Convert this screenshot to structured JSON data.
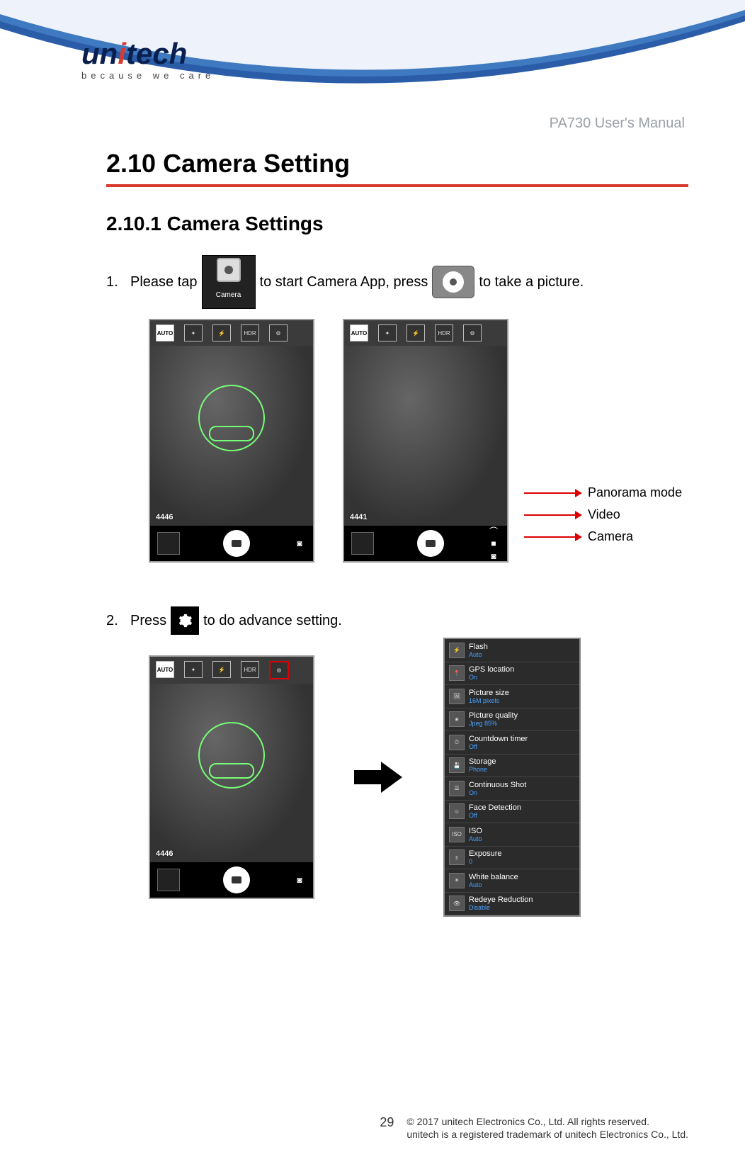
{
  "header": {
    "logo_text": "unitech",
    "tagline": "because we care",
    "manual_title": "PA730 User's Manual"
  },
  "section": {
    "heading": "2.10 Camera Setting",
    "subheading": "2.10.1 Camera Settings"
  },
  "steps": {
    "s1_num": "1.",
    "s1_a": "Please tap",
    "s1_b": "to start Camera App, press",
    "s1_c": "to take a picture.",
    "s2_num": "2.",
    "s2_a": "Press",
    "s2_b": "to do advance setting."
  },
  "cam_app": {
    "label": "Camera"
  },
  "top_icons": {
    "auto": "AUTO",
    "wand": "✦",
    "flash": "⚡",
    "hdr": "HDR",
    "gear": "⚙"
  },
  "counts": {
    "left": "4446",
    "right": "4441",
    "row2": "4446"
  },
  "mode_labels": {
    "panorama": "Panorama mode",
    "video": "Video",
    "camera": "Camera"
  },
  "mode_glyphs": {
    "panorama": "⌒",
    "video": "■",
    "camera": "◙"
  },
  "settings_list": [
    {
      "name": "Flash",
      "value": "Auto",
      "icon": "⚡"
    },
    {
      "name": "GPS location",
      "value": "On",
      "icon": "📍"
    },
    {
      "name": "Picture size",
      "value": "16M pixels",
      "icon": "🖼"
    },
    {
      "name": "Picture quality",
      "value": "Jpeg 85%",
      "icon": "★"
    },
    {
      "name": "Countdown timer",
      "value": "Off",
      "icon": "⏱"
    },
    {
      "name": "Storage",
      "value": "Phone",
      "icon": "💾"
    },
    {
      "name": "Continuous Shot",
      "value": "On",
      "icon": "☰"
    },
    {
      "name": "Face Detection",
      "value": "Off",
      "icon": "☺"
    },
    {
      "name": "ISO",
      "value": "Auto",
      "icon": "ISO"
    },
    {
      "name": "Exposure",
      "value": "0",
      "icon": "±"
    },
    {
      "name": "White balance",
      "value": "Auto",
      "icon": "☀"
    },
    {
      "name": "Redeye Reduction",
      "value": "Disable",
      "icon": "👁"
    }
  ],
  "footer": {
    "page_number": "29",
    "line1": "© 2017 unitech Electronics Co., Ltd. All rights reserved.",
    "line2": "unitech is a registered trademark of unitech Electronics Co., Ltd."
  }
}
